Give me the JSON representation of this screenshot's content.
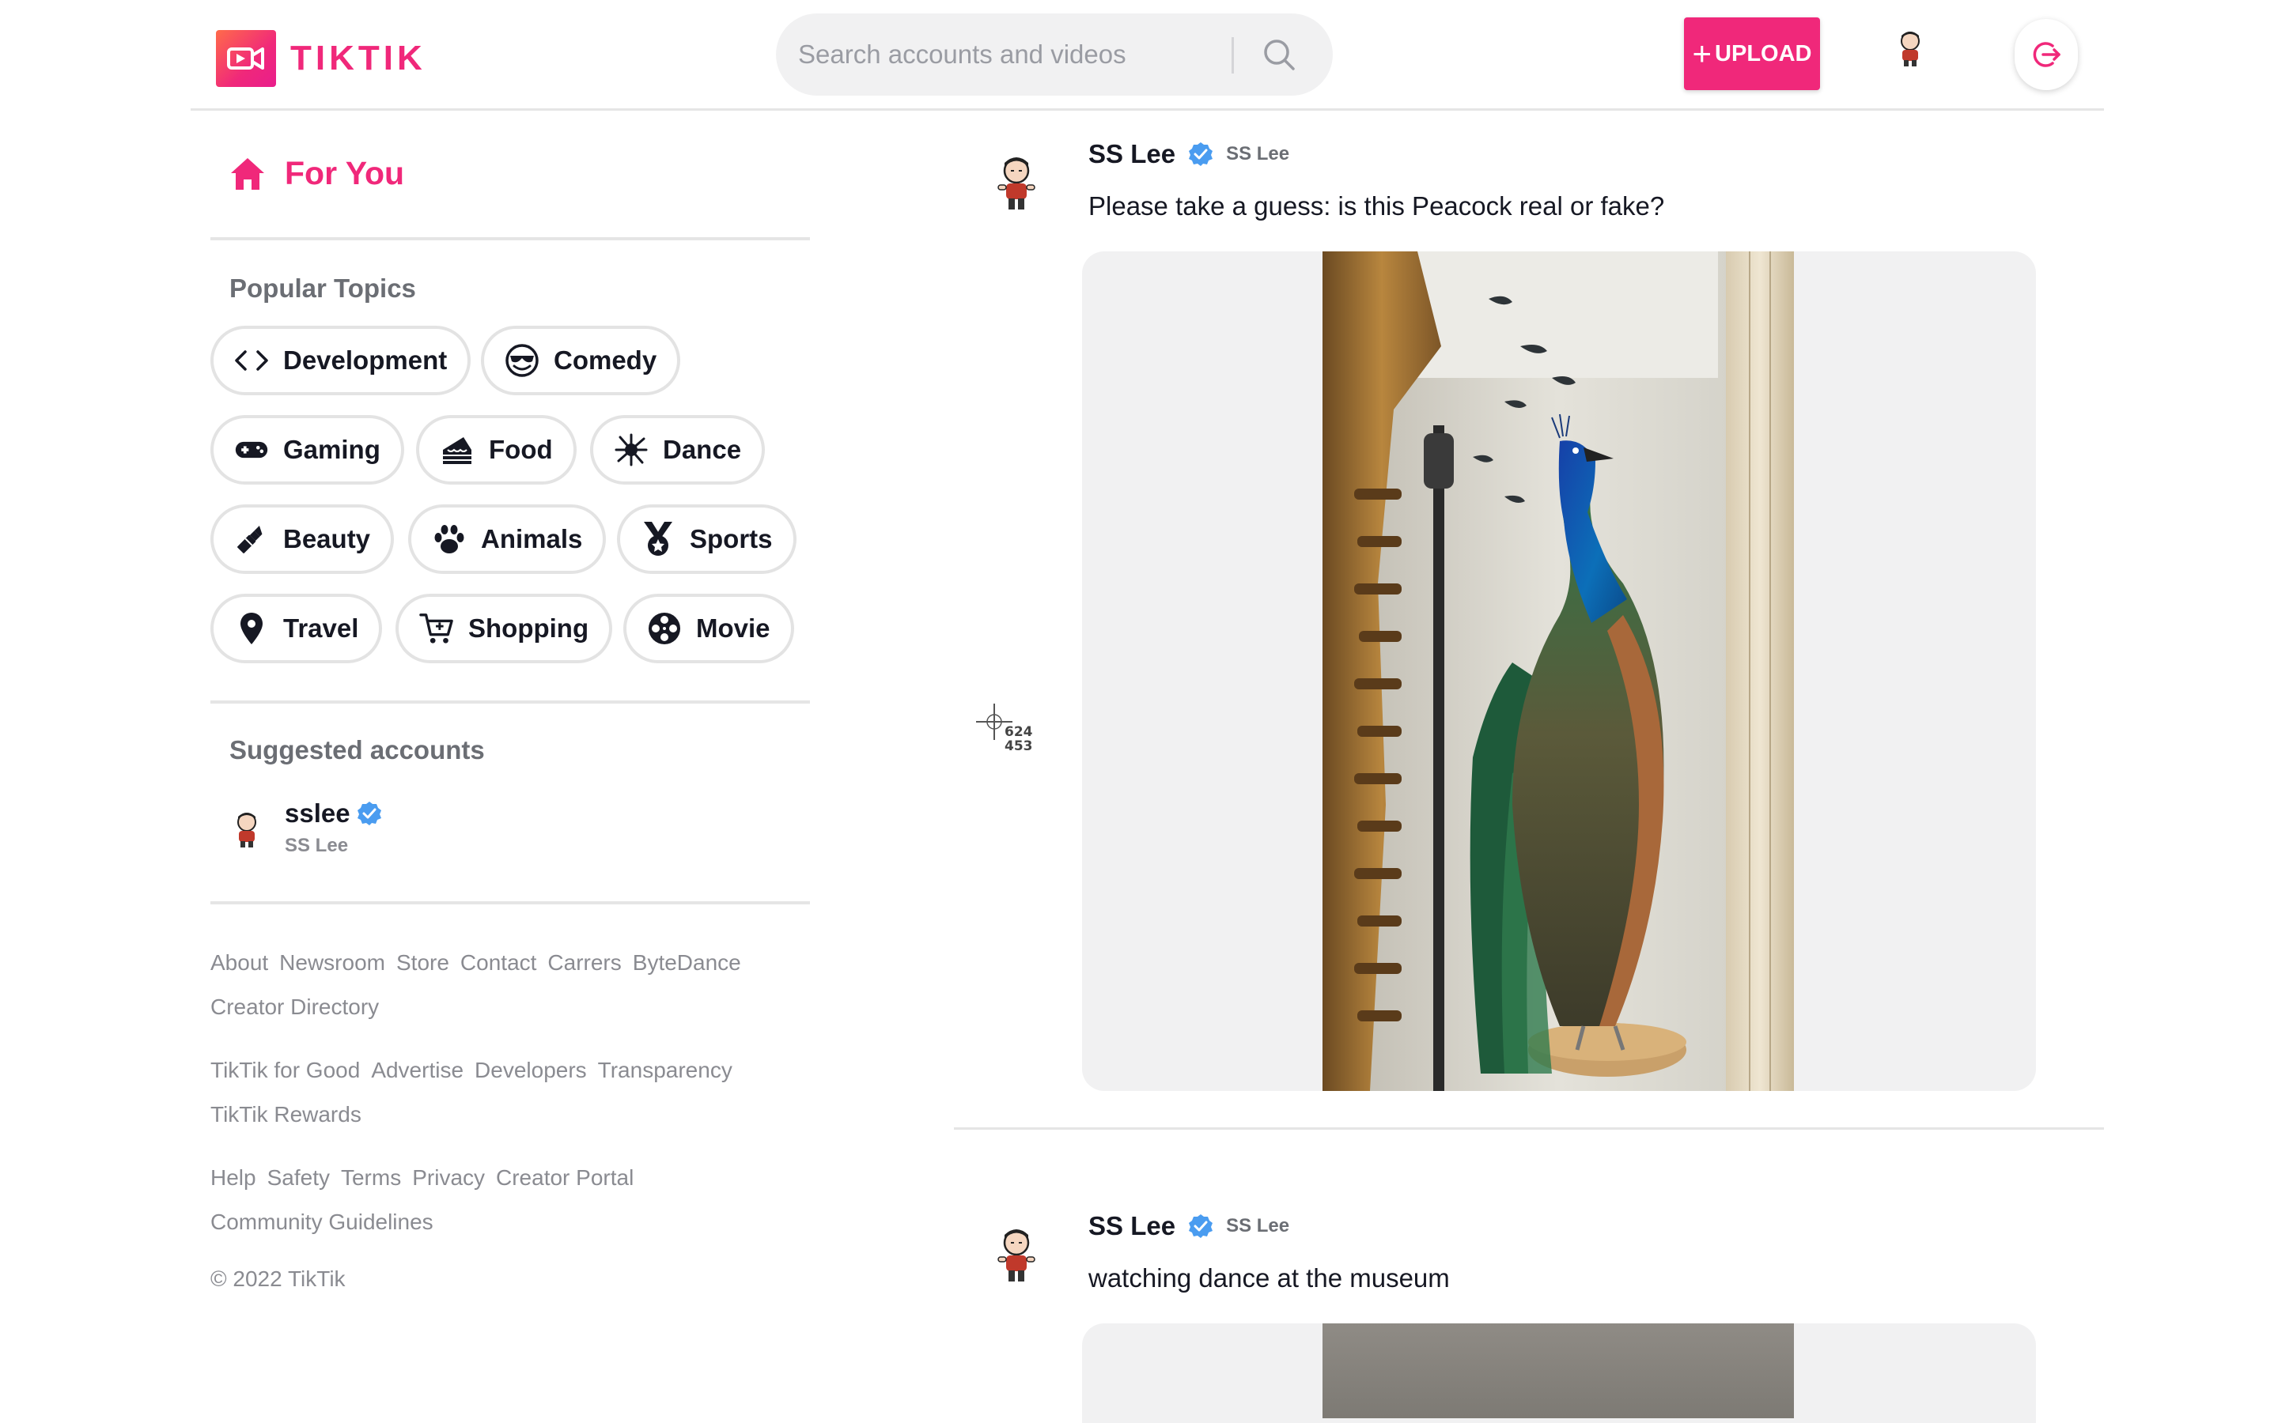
{
  "app": {
    "name": "TIKTIK"
  },
  "header": {
    "search_placeholder": "Search accounts and videos",
    "upload_label": "UPLOAD"
  },
  "sidebar": {
    "for_you_label": "For You",
    "popular_topics_title": "Popular Topics",
    "topics": [
      {
        "label": "Development",
        "icon": "code-icon"
      },
      {
        "label": "Comedy",
        "icon": "sunglasses-smile-icon"
      },
      {
        "label": "Gaming",
        "icon": "gamepad-icon"
      },
      {
        "label": "Food",
        "icon": "cake-icon"
      },
      {
        "label": "Dance",
        "icon": "dance-icon"
      },
      {
        "label": "Beauty",
        "icon": "lipstick-icon"
      },
      {
        "label": "Animals",
        "icon": "paw-icon"
      },
      {
        "label": "Sports",
        "icon": "medal-icon"
      },
      {
        "label": "Travel",
        "icon": "location-pin-icon"
      },
      {
        "label": "Shopping",
        "icon": "cart-icon"
      },
      {
        "label": "Movie",
        "icon": "film-reel-icon"
      }
    ],
    "suggested_title": "Suggested accounts",
    "suggested_accounts": [
      {
        "username": "sslee",
        "display_name": "SS Lee"
      }
    ],
    "footer_groups": [
      [
        "About",
        "Newsroom",
        "Store",
        "Contact",
        "Carrers",
        "ByteDance",
        "Creator Directory"
      ],
      [
        "TikTik for Good",
        "Advertise",
        "Developers",
        "Transparency",
        "TikTik Rewards"
      ],
      [
        "Help",
        "Safety",
        "Terms",
        "Privacy",
        "Creator Portal",
        "Community Guidelines"
      ]
    ],
    "copyright": "© 2022 TikTik"
  },
  "feed": {
    "posts": [
      {
        "name": "SS Lee",
        "handle": "SS Lee",
        "caption": "Please take a guess: is this Peacock real or fake?"
      },
      {
        "name": "SS Lee",
        "handle": "SS Lee",
        "caption": "watching dance at the museum"
      }
    ]
  },
  "cursor_readout": {
    "x": "624",
    "y": "453"
  },
  "colors": {
    "brand": "#f0287a",
    "verified": "#4a9cf0",
    "muted_text": "#8a8b91"
  }
}
